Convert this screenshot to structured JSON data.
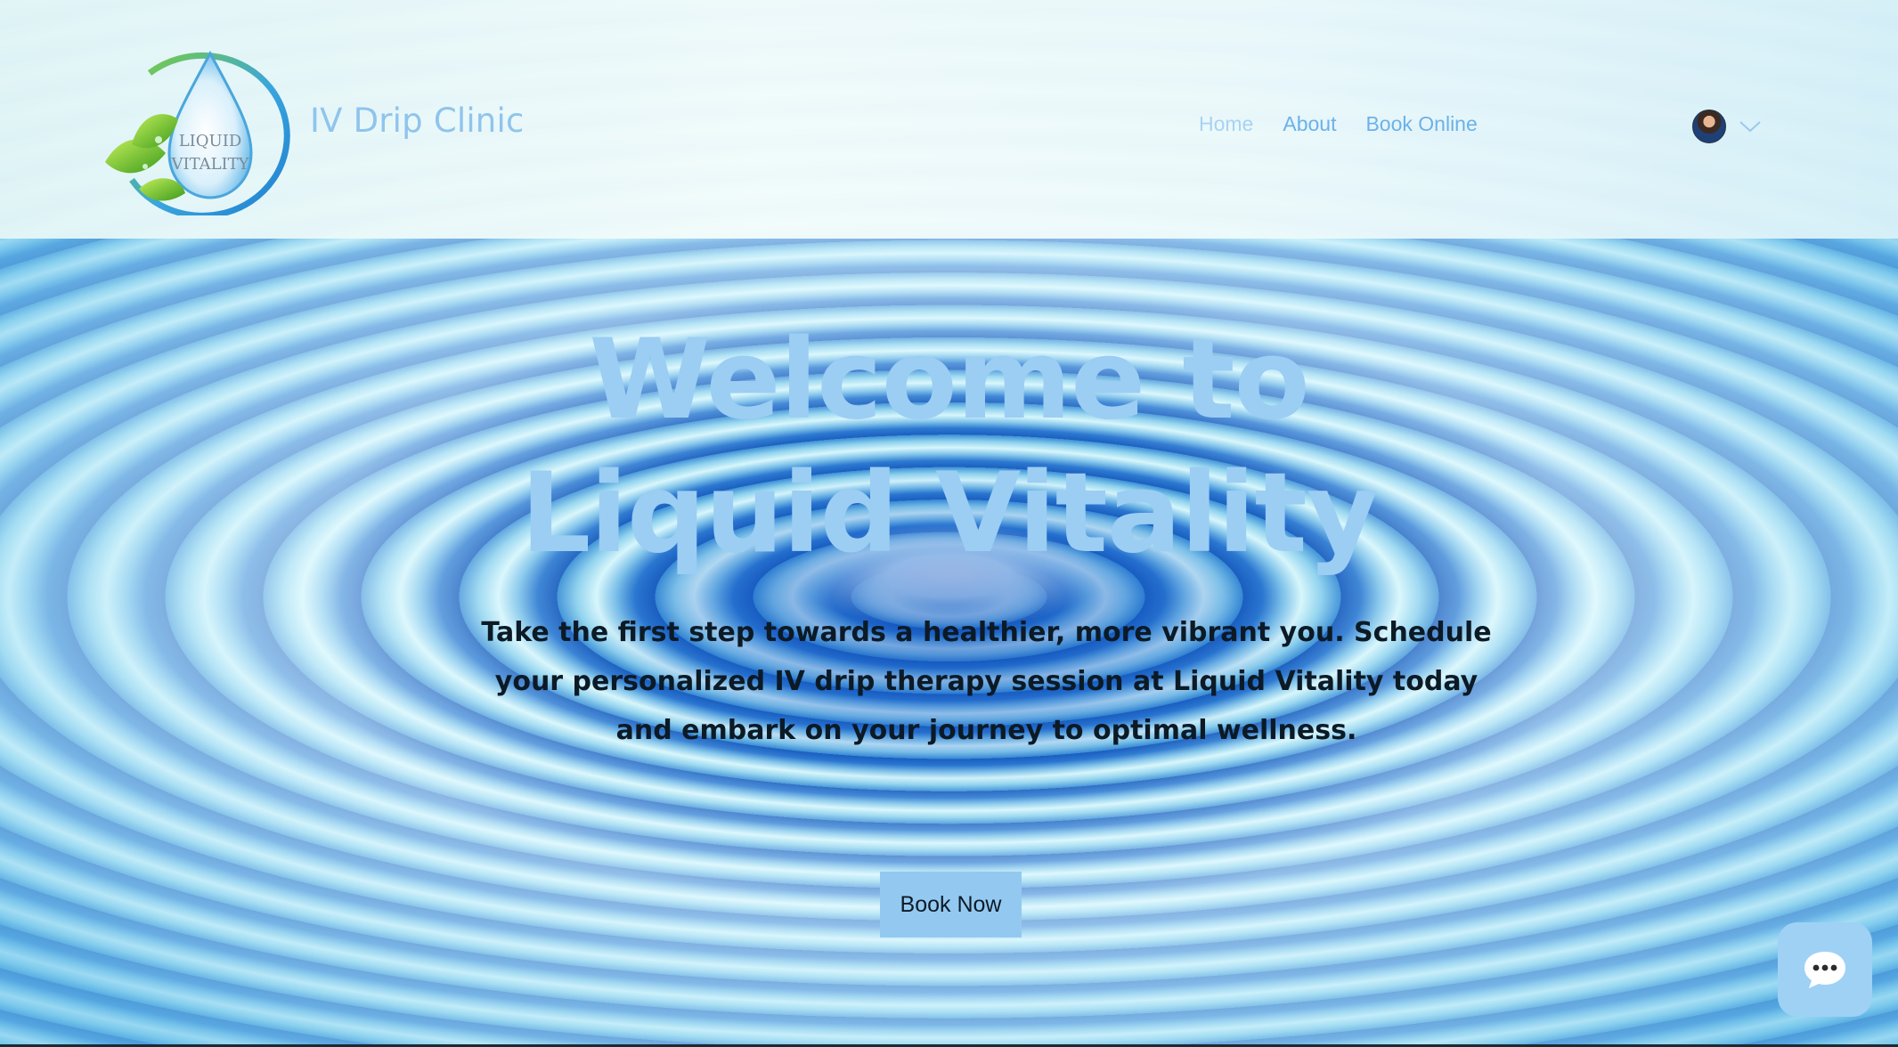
{
  "header": {
    "logo_text": "Liquid Vitality",
    "site_title": "IV Drip Clinic",
    "nav": [
      {
        "label": "Home"
      },
      {
        "label": "About"
      },
      {
        "label": "Book Online"
      }
    ]
  },
  "hero": {
    "headline_line1": "Welcome to",
    "headline_line2": "Liquid Vitality",
    "subtext": "Take the first step towards a healthier, more vibrant you. Schedule your personalized IV drip therapy session at Liquid Vitality today and embark on your journey to optimal wellness.",
    "cta_label": "Book Now"
  },
  "icons": {
    "logo": "water-drop-leaf-logo-icon",
    "avatar": "user-avatar",
    "account_menu": "chevron-down-icon",
    "chat": "chat-bubble-icon"
  },
  "colors": {
    "accent": "#93c9f1",
    "nav_text": "#6cb1e8",
    "headline": "#9ccdf3"
  }
}
